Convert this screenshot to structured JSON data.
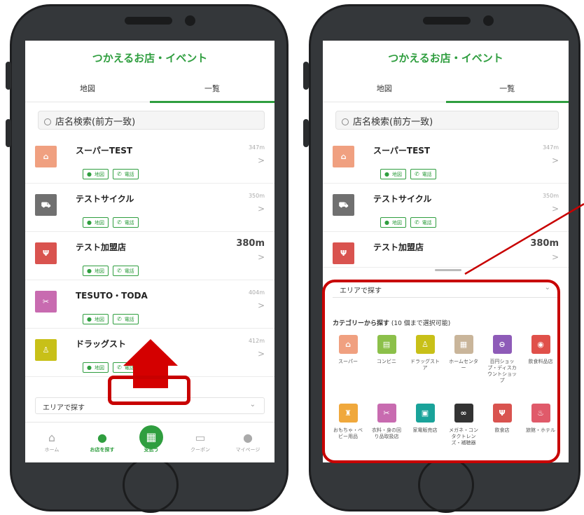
{
  "colors": {
    "brand_green": "#2f9e3f",
    "annotation_red": "#c80000"
  },
  "left_screen": {
    "title": "つかえるお店・イベント",
    "tabs": [
      "地図",
      "一覧"
    ],
    "search_placeholder": "店名検索(前方一致)",
    "stores": [
      {
        "name": "スーパーTEST",
        "distance": "347m",
        "icon": "shop-icon",
        "color": "#f0a080",
        "glyph": "⌂"
      },
      {
        "name": "テストサイクル",
        "distance": "350m",
        "icon": "car-bicycle-icon",
        "color": "#707070",
        "glyph": "⛟"
      },
      {
        "name": "テスト加盟店",
        "distance": "380m",
        "icon": "fork-knife-icon",
        "color": "#d9534f",
        "glyph": "Ψ"
      },
      {
        "name": "TESUTO・TODA",
        "distance": "404m",
        "icon": "beauty-icon",
        "color": "#c86bb0",
        "glyph": "✂"
      },
      {
        "name": "ドラッグスト",
        "distance": "412m",
        "icon": "drugstore-icon",
        "color": "#c8c018",
        "glyph": "♙"
      }
    ],
    "map_chip": "地図",
    "phone_chip": "電話",
    "area_label": "エリアで探す",
    "nav": [
      "ホーム",
      "お店を探す",
      "支払う",
      "クーポン",
      "マイページ"
    ]
  },
  "right_screen": {
    "title": "つかえるお店・イベント",
    "tabs": [
      "地図",
      "一覧"
    ],
    "search_placeholder": "店名検索(前方一致)",
    "stores": [
      {
        "name": "スーパーTEST",
        "distance": "347m"
      },
      {
        "name": "テストサイクル",
        "distance": "350m"
      },
      {
        "name": "テスト加盟店",
        "distance": "380m"
      }
    ],
    "map_chip": "地図",
    "phone_chip": "電話",
    "area_label": "エリアで探す",
    "category_heading": "カテゴリーから探す",
    "category_note": "(10 個まで選択可能)",
    "categories": [
      {
        "label": "スーパー",
        "color": "#f0a080",
        "glyph": "⌂"
      },
      {
        "label": "コンビニ",
        "color": "#8cc04a",
        "glyph": "▤"
      },
      {
        "label": "ドラッグストア",
        "color": "#c8c018",
        "glyph": "♙"
      },
      {
        "label": "ホームセンター",
        "color": "#c9b59a",
        "glyph": "▦"
      },
      {
        "label": "百円ショップ・ディスカウントショップ",
        "color": "#8e5bb8",
        "glyph": "⊖"
      },
      {
        "label": "飲食料品店",
        "color": "#e0504a",
        "glyph": "◉"
      },
      {
        "label": "おもちゃ・ベビー用品",
        "color": "#f0a83c",
        "glyph": "♜"
      },
      {
        "label": "衣料・身の回り品取扱店",
        "color": "#c86bb0",
        "glyph": "✂"
      },
      {
        "label": "家電販売店",
        "color": "#1aa39a",
        "glyph": "▣"
      },
      {
        "label": "メガネ・コンタクトレンズ・補聴器",
        "color": "#333333",
        "glyph": "∞"
      },
      {
        "label": "飲食店",
        "color": "#d9534f",
        "glyph": "Ψ"
      },
      {
        "label": "旅館・ホテル",
        "color": "#e05a6a",
        "glyph": "♨"
      }
    ]
  }
}
